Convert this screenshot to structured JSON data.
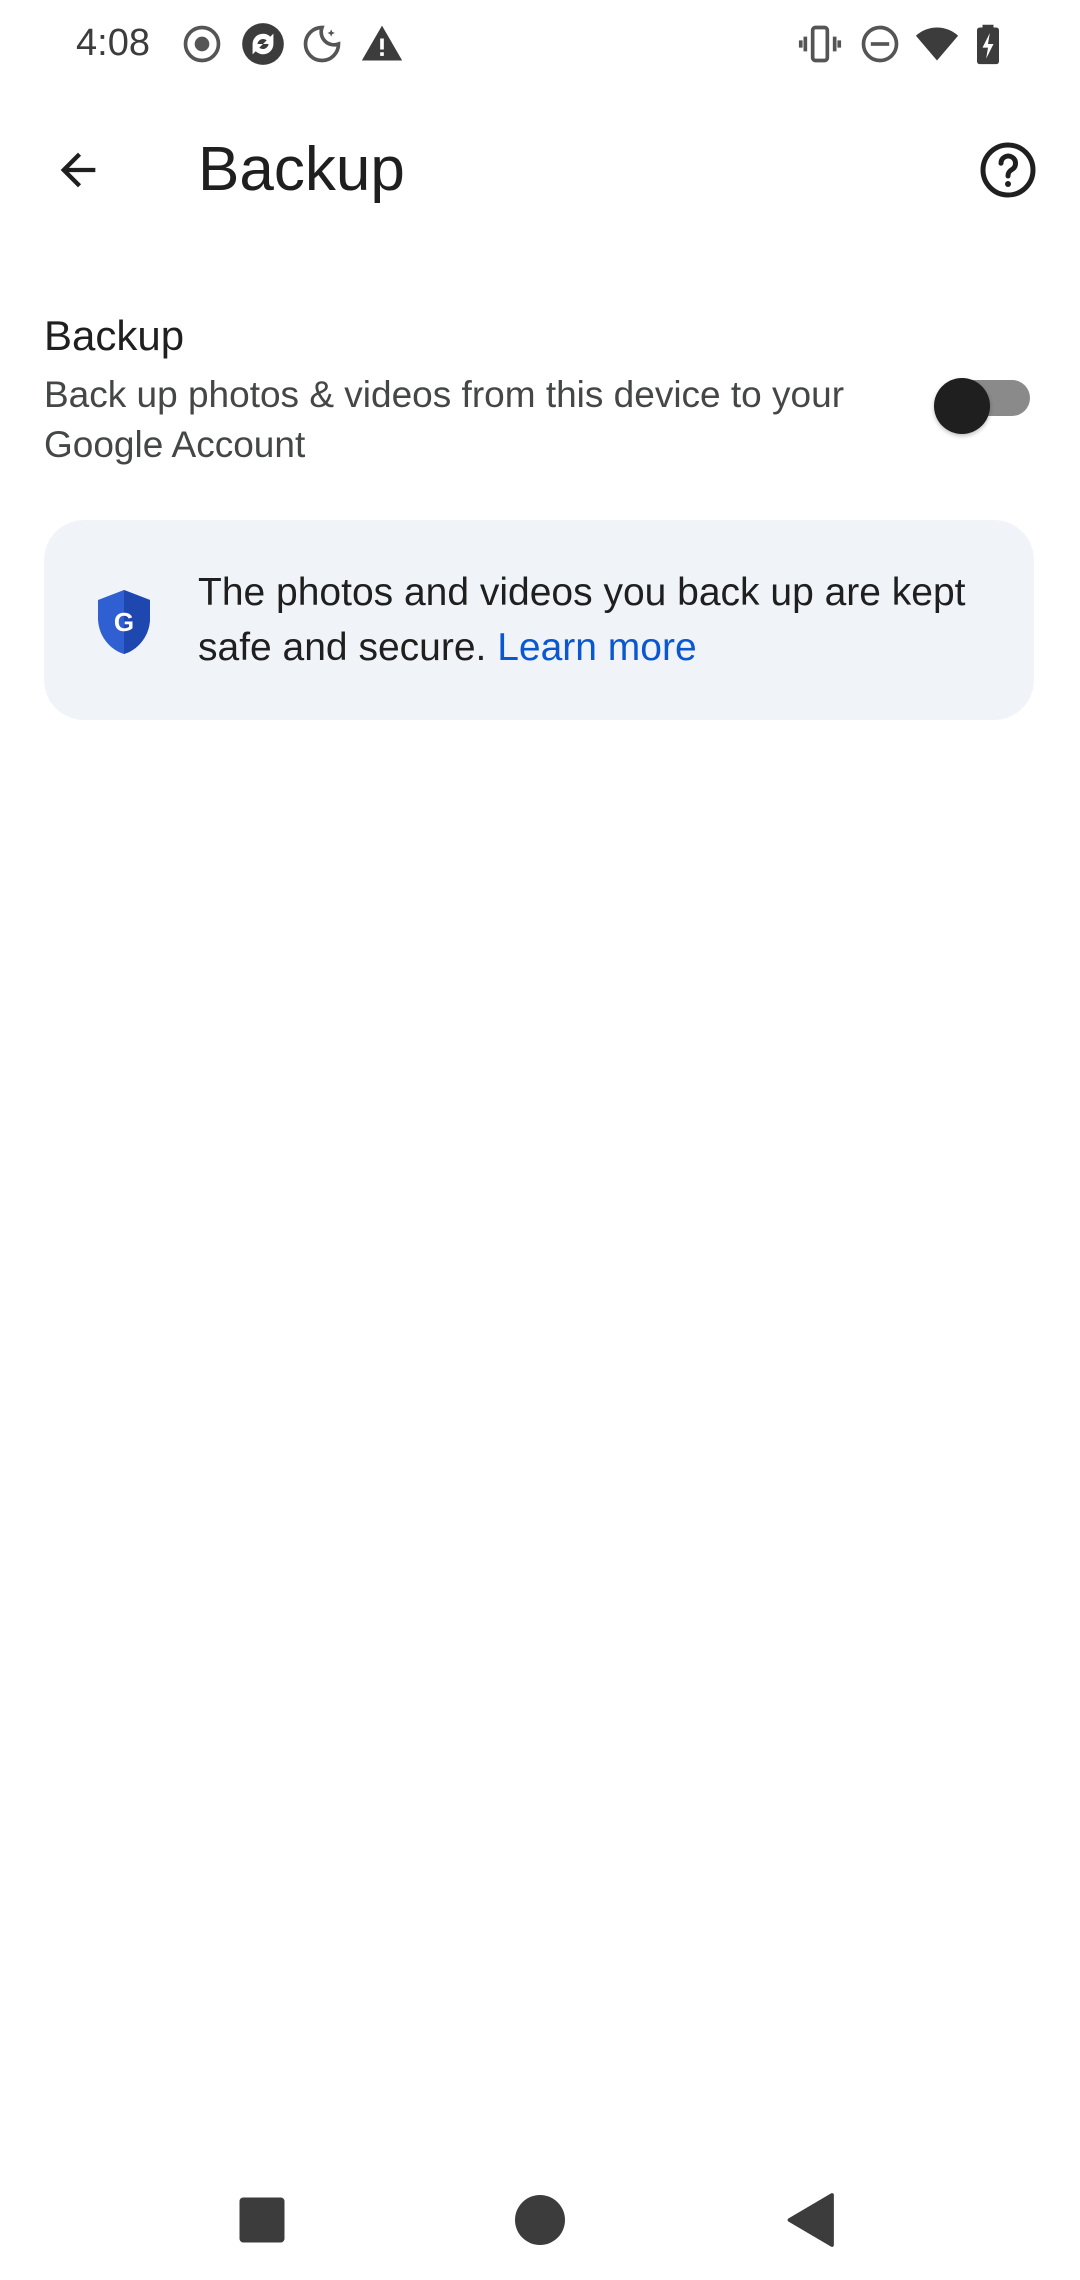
{
  "status_bar": {
    "time": "4:08",
    "left_icons": [
      "record-icon",
      "sync-icon",
      "night-mode-icon",
      "warning-icon"
    ],
    "right_icons": [
      "vibrate-icon",
      "do-not-disturb-icon",
      "wifi-icon",
      "battery-charging-icon"
    ]
  },
  "app_bar": {
    "title": "Backup",
    "back_icon": "arrow-back-icon",
    "help_icon": "help-icon"
  },
  "backup_setting": {
    "title": "Backup",
    "description": "Back up photos & videos from this device to your Google Account",
    "toggle_state": "off"
  },
  "info_card": {
    "text": "The photos and videos you back up are kept safe and secure.",
    "link_label": "Learn more",
    "icon": "google-shield-icon"
  },
  "nav_bar": {
    "buttons": [
      "recents-square-icon",
      "home-circle-icon",
      "back-triangle-icon"
    ]
  },
  "colors": {
    "background": "#ffffff",
    "card_background": "#f0f4f9",
    "link": "#0b57d0",
    "shield": "#2f5fd0",
    "text_primary": "#1f1f1f",
    "text_secondary": "#444746"
  }
}
